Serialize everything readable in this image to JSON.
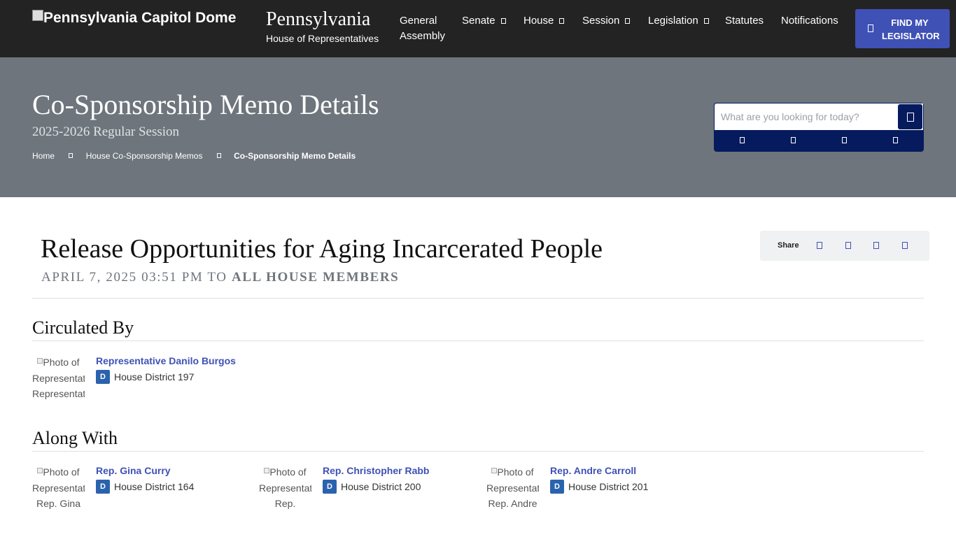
{
  "header": {
    "logo_alt": "Pennsylvania Capitol Dome",
    "brand_title": "Pennsylvania",
    "brand_subtitle": "House of Representatives",
    "nav": [
      {
        "label": "General"
      },
      {
        "label": "Assembly"
      },
      {
        "label": "Senate"
      },
      {
        "label": "House"
      },
      {
        "label": "Session"
      },
      {
        "label": "Legislation"
      },
      {
        "label": "Statutes"
      },
      {
        "label": "Notifications"
      }
    ],
    "find_button_line1": "FIND MY",
    "find_button_line2": "LEGISLATOR"
  },
  "hero": {
    "title": "Co-Sponsorship Memo Details",
    "session": "2025-2026 Regular Session",
    "breadcrumb": [
      "Home",
      "House Co-Sponsorship Memos",
      "Co-Sponsorship Memo Details"
    ],
    "search_placeholder": "What are you looking for today?",
    "quick_icons": [
      "bill-icon",
      "member-icon",
      "calendar-icon",
      "video-icon"
    ]
  },
  "memo": {
    "title": "Release Opportunities for Aging Incarcerated People",
    "date": "APRIL 7, 2025 03:51 PM TO",
    "recipients": "ALL HOUSE MEMBERS",
    "share_label": "Share",
    "share_icons": [
      "facebook-icon",
      "twitter-icon",
      "linkedin-icon",
      "email-icon"
    ]
  },
  "circulated_by": {
    "heading": "Circulated By",
    "people": [
      {
        "name": "Representative Danilo Burgos",
        "party": "D",
        "district": "House District 197",
        "photo_alt": "Photo of Representative Representative"
      }
    ]
  },
  "along_with": {
    "heading": "Along With",
    "people": [
      {
        "name": "Rep. Gina Curry",
        "party": "D",
        "district": "House District 164",
        "photo_alt": "Photo of Representative Rep. Gina"
      },
      {
        "name": "Rep. Christopher Rabb",
        "party": "D",
        "district": "House District 200",
        "photo_alt": "Photo of Representative Rep."
      },
      {
        "name": "Rep. Andre Carroll",
        "party": "D",
        "district": "House District 201",
        "photo_alt": "Photo of Representative Rep. Andre"
      }
    ]
  }
}
